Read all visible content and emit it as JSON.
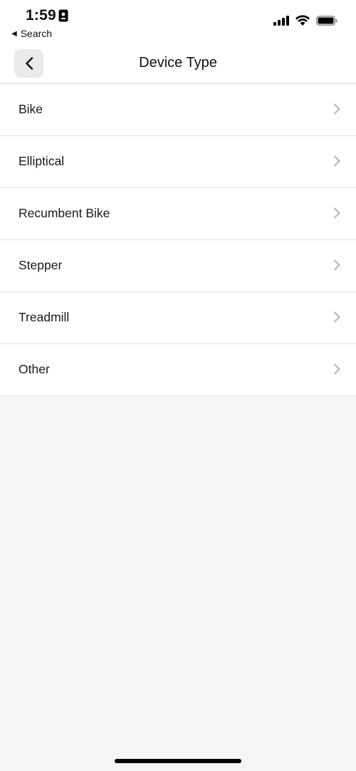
{
  "status_bar": {
    "time": "1:59",
    "back_to_app_label": "Search",
    "icons": [
      "id-card-icon",
      "cellular-signal-icon",
      "wifi-icon",
      "battery-icon"
    ]
  },
  "nav": {
    "title": "Device Type",
    "back_icon": "chevron-left-icon"
  },
  "device_types": [
    {
      "label": "Bike"
    },
    {
      "label": "Elliptical"
    },
    {
      "label": "Recumbent Bike"
    },
    {
      "label": "Stepper"
    },
    {
      "label": "Treadmill"
    },
    {
      "label": "Other"
    }
  ],
  "colors": {
    "background": "#f5f5f5",
    "surface": "#ffffff",
    "chevron": "#b5b5b5",
    "divider": "#e2e2e2"
  }
}
